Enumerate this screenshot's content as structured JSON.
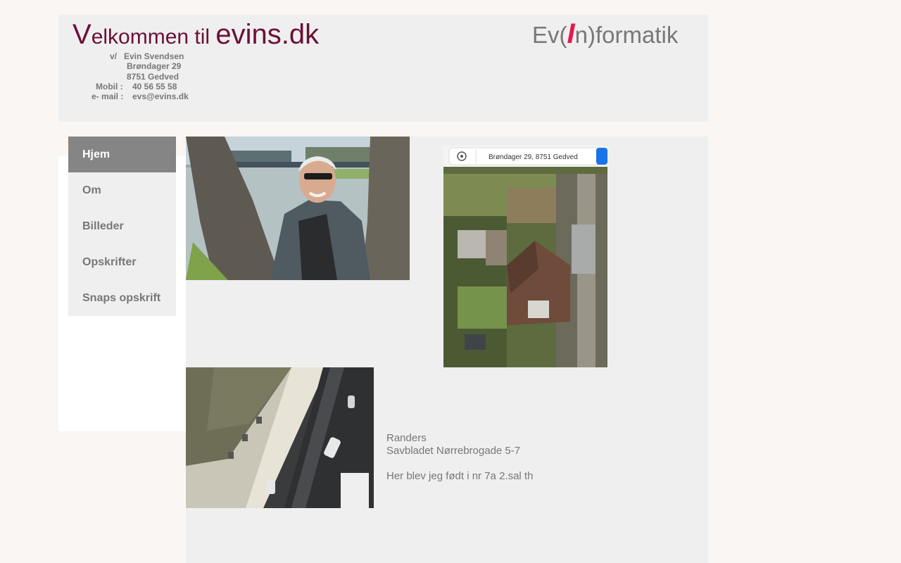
{
  "header": {
    "welcome_initial": "V",
    "welcome_rest": "elkommen til ",
    "site_name": "evins.dk",
    "logo_prefix": "Ev(",
    "logo_slash": "I",
    "logo_suffix": "n)formatik"
  },
  "contact": {
    "prefix": "v/",
    "name": "Evin Svendsen",
    "street": "Brøndager 29",
    "city": "8751 Gedved",
    "mobile_label": "Mobil :",
    "mobile": "40 56 55 58",
    "email_label": "e- mail :",
    "email": "evs@evins.dk"
  },
  "nav": {
    "items": [
      {
        "label": "Hjem",
        "active": true
      },
      {
        "label": "Om",
        "active": false
      },
      {
        "label": "Billeder",
        "active": false
      },
      {
        "label": "Opskrifter",
        "active": false
      },
      {
        "label": "Snaps opskrift",
        "active": false
      }
    ]
  },
  "map": {
    "search_text": "Brøndager 29, 8751 Gedved"
  },
  "caption": {
    "line1": "Randers",
    "line2": "Savbladet Nørrebrogade 5-7",
    "line3": "Her blev jeg født i nr 7a  2.sal th"
  },
  "colors": {
    "brand": "#6b1038",
    "accent": "#e8174f",
    "nav_active": "#858585",
    "panel": "#efefef"
  }
}
